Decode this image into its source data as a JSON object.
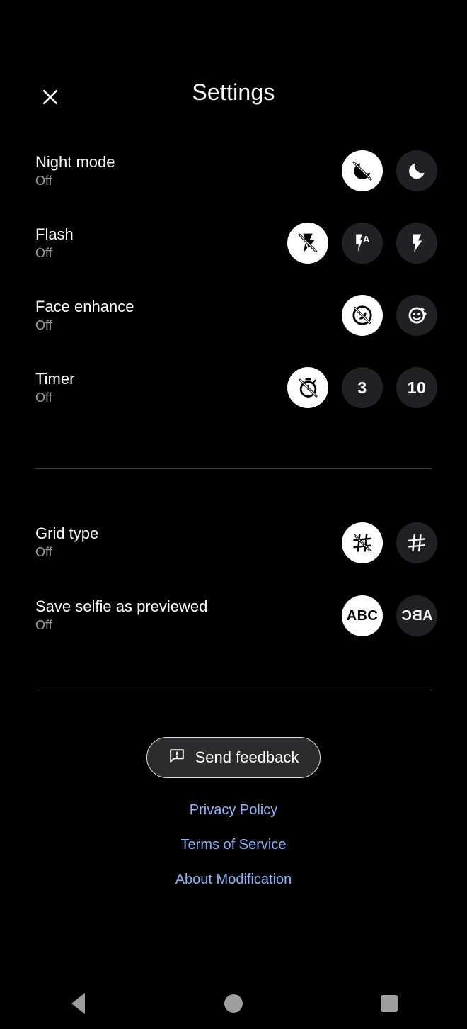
{
  "header": {
    "title": "Settings",
    "close_icon": "close-icon"
  },
  "settings_groups": [
    {
      "id": "capture",
      "rows": [
        {
          "id": "night-mode",
          "label": "Night mode",
          "value": "Off",
          "options": [
            {
              "id": "night-off",
              "icon": "night-mode-off-icon",
              "label": "",
              "selected": true
            },
            {
              "id": "night-on",
              "icon": "moon-icon",
              "label": "",
              "selected": false
            }
          ]
        },
        {
          "id": "flash",
          "label": "Flash",
          "value": "Off",
          "options": [
            {
              "id": "flash-off",
              "icon": "flash-off-icon",
              "label": "",
              "selected": true
            },
            {
              "id": "flash-auto",
              "icon": "flash-auto-icon",
              "label": "",
              "selected": false
            },
            {
              "id": "flash-on",
              "icon": "flash-on-icon",
              "label": "",
              "selected": false
            }
          ]
        },
        {
          "id": "face-enhance",
          "label": "Face enhance",
          "value": "Off",
          "options": [
            {
              "id": "face-off",
              "icon": "face-enhance-off-icon",
              "label": "",
              "selected": true
            },
            {
              "id": "face-on",
              "icon": "face-sparkle-icon",
              "label": "",
              "selected": false
            }
          ]
        },
        {
          "id": "timer",
          "label": "Timer",
          "value": "Off",
          "options": [
            {
              "id": "timer-off",
              "icon": "timer-off-icon",
              "label": "",
              "selected": true
            },
            {
              "id": "timer-3",
              "icon": "",
              "label": "3",
              "selected": false
            },
            {
              "id": "timer-10",
              "icon": "",
              "label": "10",
              "selected": false
            }
          ]
        }
      ]
    },
    {
      "id": "output",
      "rows": [
        {
          "id": "grid-type",
          "label": "Grid type",
          "value": "Off",
          "options": [
            {
              "id": "grid-off",
              "icon": "grid-off-icon",
              "label": "",
              "selected": true
            },
            {
              "id": "grid-on",
              "icon": "grid-on-icon",
              "label": "",
              "selected": false
            }
          ]
        },
        {
          "id": "save-selfie-as-previewed",
          "label": "Save selfie as previewed",
          "value": "Off",
          "options": [
            {
              "id": "selfie-normal",
              "icon": "",
              "label": "ABC",
              "selected": true,
              "mirrored": false
            },
            {
              "id": "selfie-mirrored",
              "icon": "",
              "label": "ABC",
              "selected": false,
              "mirrored": true
            }
          ]
        }
      ]
    }
  ],
  "footer": {
    "feedback_label": "Send feedback",
    "feedback_icon": "feedback-icon",
    "links": [
      {
        "id": "privacy-policy",
        "label": "Privacy Policy"
      },
      {
        "id": "terms-of-service",
        "label": "Terms of Service"
      },
      {
        "id": "about-modification",
        "label": "About Modification"
      }
    ]
  },
  "navbar": {
    "back_label": "Back",
    "home_label": "Home",
    "recents_label": "Recents"
  },
  "colors": {
    "background": "#000000",
    "selected_pill": "#ffffff",
    "unselected_pill": "#202124",
    "link": "#8ab4f8",
    "secondary_text": "#9aa0a6",
    "divider": "#3c4043",
    "nav_icon": "#9e9e9e"
  }
}
